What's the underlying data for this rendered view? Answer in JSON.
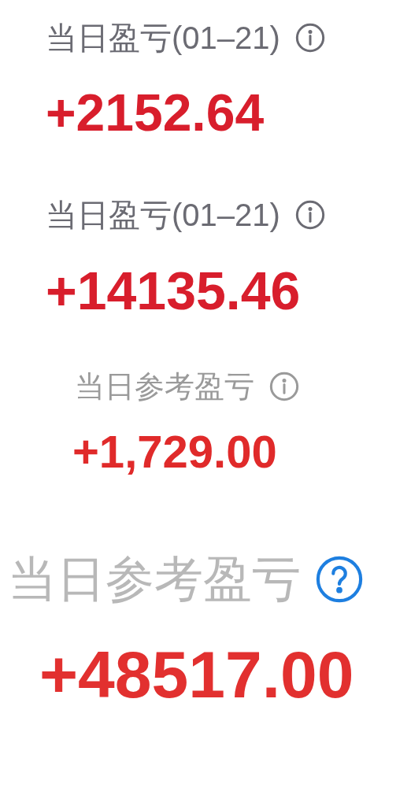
{
  "blocks": [
    {
      "label": "当日盈亏(01–21)",
      "kind": "info",
      "value": "+2152.64"
    },
    {
      "label": "当日盈亏(01–21)",
      "kind": "info",
      "value": "+14135.46"
    },
    {
      "label": "当日参考盈亏",
      "kind": "info",
      "value": "+1,729.00"
    },
    {
      "label": "当日参考盈亏",
      "kind": "help",
      "value": "+48517.00"
    }
  ]
}
